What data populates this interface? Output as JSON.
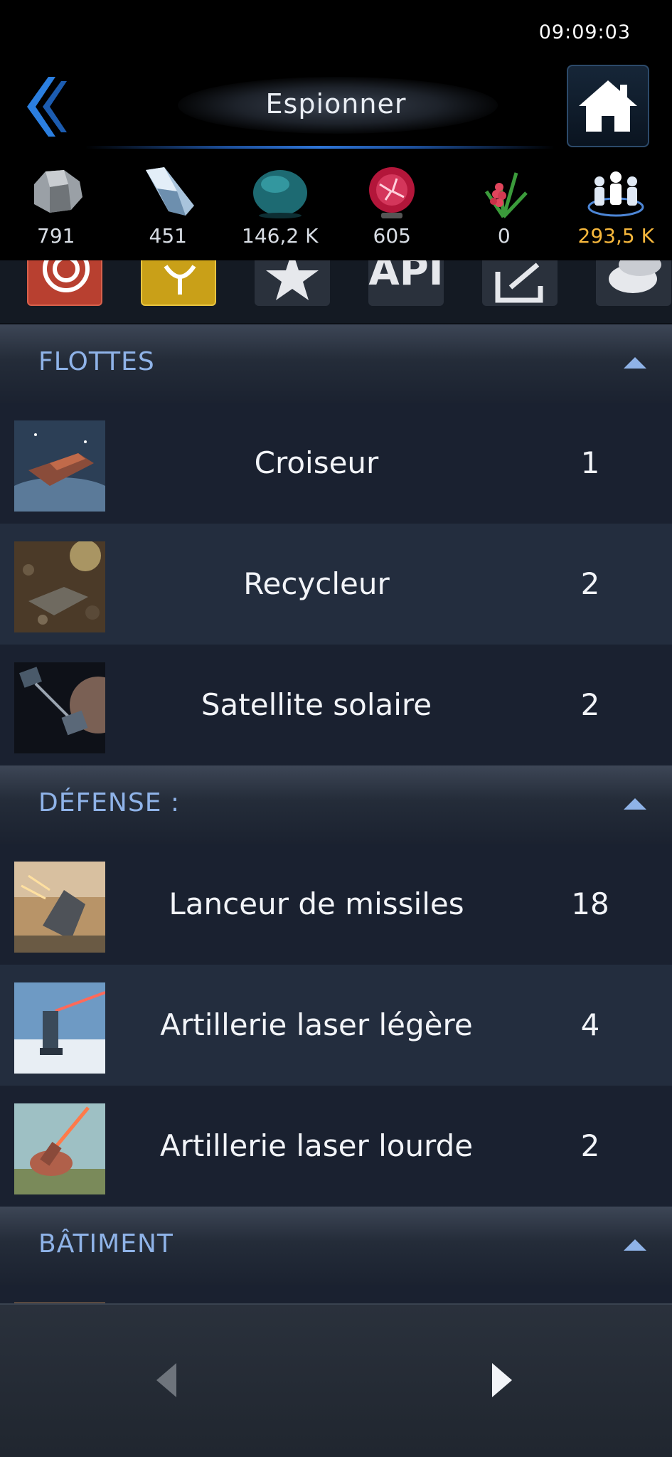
{
  "status": {
    "time": "09:09:03"
  },
  "header": {
    "title": "Espionner"
  },
  "resources": [
    {
      "icon": "metal-rock-icon",
      "value": "791",
      "color": "#d8dde4"
    },
    {
      "icon": "crystal-icon",
      "value": "451",
      "color": "#d8dde4"
    },
    {
      "icon": "deuterium-orb-icon",
      "value": "146,2 K",
      "color": "#d8dde4"
    },
    {
      "icon": "energy-plasma-icon",
      "value": "605",
      "color": "#d8dde4"
    },
    {
      "icon": "food-plant-icon",
      "value": "0",
      "color": "#d8dde4"
    },
    {
      "icon": "population-icon",
      "value": "293,5 K",
      "color": "#f6b73c"
    }
  ],
  "iconstrip": {
    "api_label": "API"
  },
  "sections": {
    "fleets": {
      "title": "FLOTTES",
      "items": [
        {
          "name": "Croiseur",
          "count": "1"
        },
        {
          "name": "Recycleur",
          "count": "2"
        },
        {
          "name": "Satellite solaire",
          "count": "2"
        }
      ]
    },
    "defense": {
      "title": "DÉFENSE :",
      "items": [
        {
          "name": "Lanceur de missiles",
          "count": "18"
        },
        {
          "name": "Artillerie laser légère",
          "count": "4"
        },
        {
          "name": "Artillerie laser lourde",
          "count": "2"
        }
      ]
    },
    "buildings": {
      "title": "BÂTIMENT"
    }
  },
  "colors": {
    "accent": "#8fb3e8",
    "gold": "#f6b73c",
    "row_dark": "#1a2130",
    "row_light": "#232d3e"
  }
}
